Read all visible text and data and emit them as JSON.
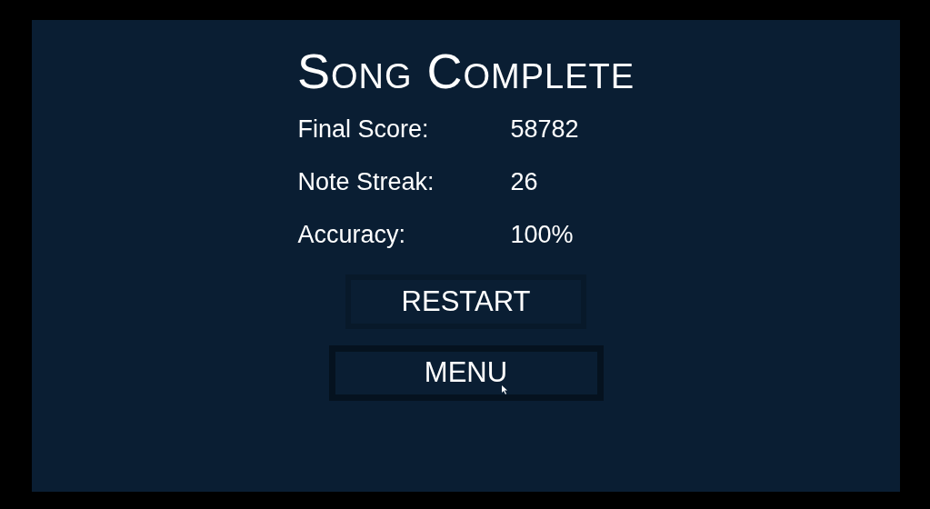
{
  "title": "Song Complete",
  "stats": [
    {
      "label": "Final Score:",
      "value": "58782"
    },
    {
      "label": "Note Streak:",
      "value": "26"
    },
    {
      "label": "Accuracy:",
      "value": "100%"
    }
  ],
  "buttons": [
    {
      "label": "RESTART",
      "hovered": false
    },
    {
      "label": "MENU",
      "hovered": true
    }
  ]
}
